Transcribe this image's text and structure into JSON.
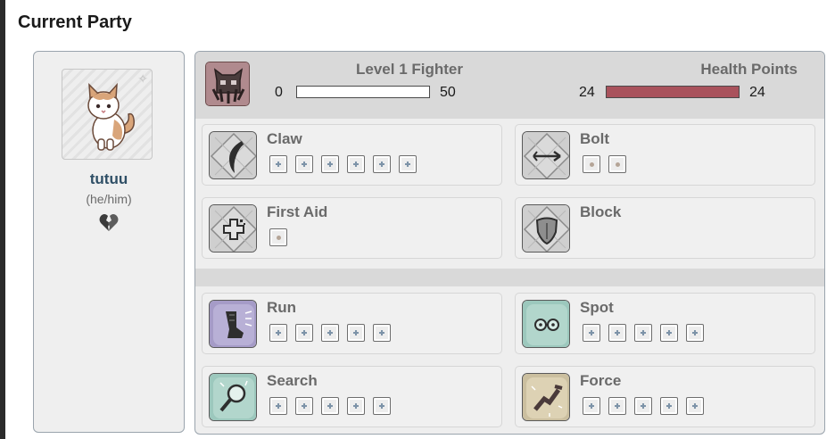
{
  "section_title": "Current Party",
  "pet": {
    "name": "tutuu",
    "pronouns": "(he/him)"
  },
  "stats": {
    "level_title": "Level 1 Fighter",
    "xp_current": "0",
    "xp_max": "50",
    "xp_fraction": 0.0,
    "hp_title": "Health Points",
    "hp_current": "24",
    "hp_max": "24",
    "hp_fraction": 1.0,
    "hp_color": "#a9525c"
  },
  "combat_skills": [
    {
      "name": "Claw",
      "icon": "claw-icon",
      "pips": [
        "blue",
        "blue",
        "blue",
        "blue",
        "blue",
        "blue"
      ]
    },
    {
      "name": "Bolt",
      "icon": "bolt-arrow-icon",
      "pips": [
        "tan",
        "tan"
      ]
    },
    {
      "name": "First Aid",
      "icon": "first-aid-icon",
      "pips": [
        "tan"
      ]
    },
    {
      "name": "Block",
      "icon": "shield-icon",
      "pips": []
    }
  ],
  "utility_skills": [
    {
      "name": "Run",
      "icon": "boot-icon",
      "pips": [
        "blue",
        "blue",
        "blue",
        "blue",
        "blue"
      ]
    },
    {
      "name": "Spot",
      "icon": "eyes-icon",
      "pips": [
        "blue",
        "blue",
        "blue",
        "blue",
        "blue"
      ]
    },
    {
      "name": "Search",
      "icon": "magnifier-icon",
      "pips": [
        "blue",
        "blue",
        "blue",
        "blue",
        "blue"
      ]
    },
    {
      "name": "Force",
      "icon": "crowbar-icon",
      "pips": [
        "blue",
        "blue",
        "blue",
        "blue",
        "blue"
      ]
    }
  ]
}
